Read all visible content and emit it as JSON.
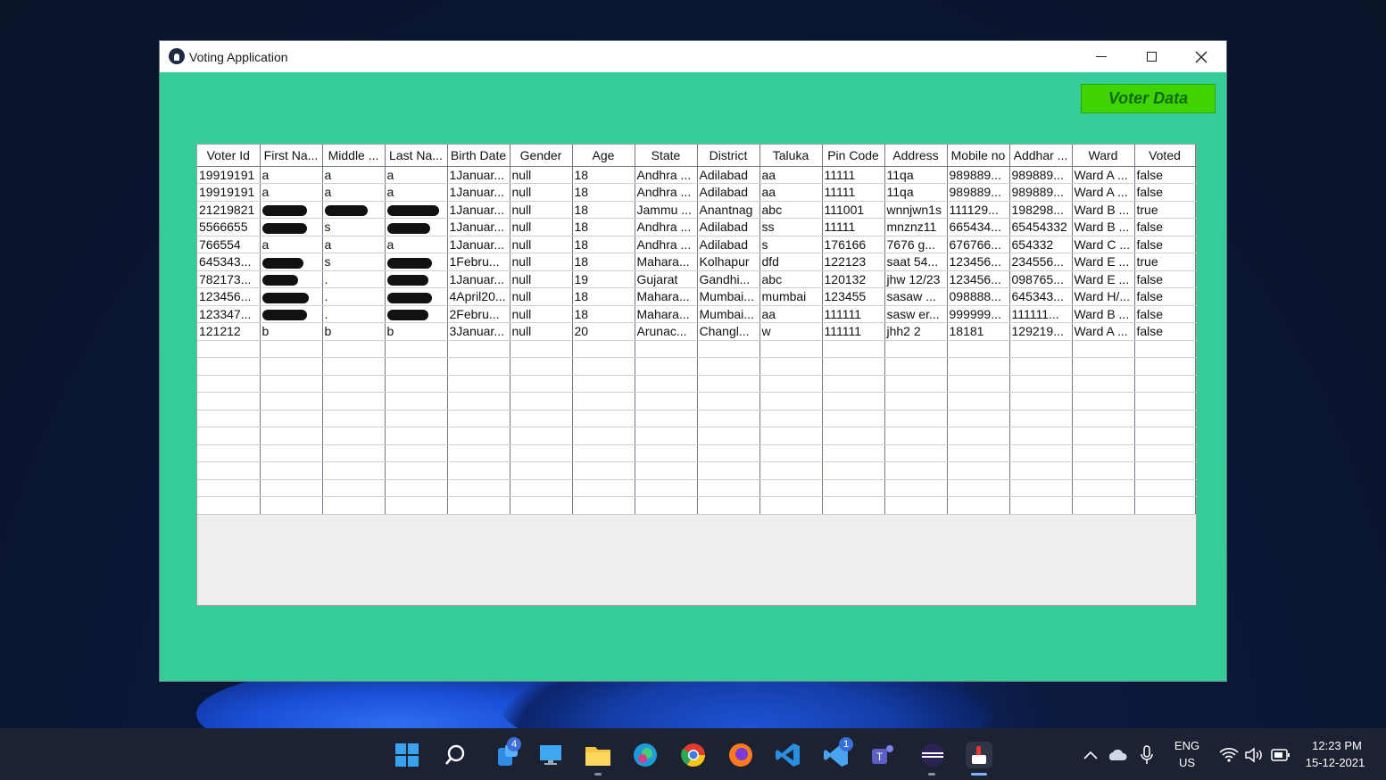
{
  "window": {
    "title": "Voting Application",
    "voter_data_button": "Voter Data"
  },
  "table": {
    "columns": [
      "Voter Id",
      "First Na...",
      "Middle ...",
      "Last Na...",
      "Birth Date",
      "Gender",
      "Age",
      "State",
      "District",
      "Taluka",
      "Pin Code",
      "Address",
      "Mobile no",
      "Addhar ...",
      "Ward",
      "Voted"
    ],
    "rows": [
      [
        "19919191",
        "a",
        "a",
        "a",
        "1Januar...",
        "null",
        "18",
        "Andhra ...",
        "Adilabad",
        "aa",
        "11111",
        "11qa",
        "989889...",
        "989889...",
        "Ward A ...",
        "false"
      ],
      [
        "19919191",
        "a",
        "a",
        "a",
        "1Januar...",
        "null",
        "18",
        "Andhra ...",
        "Adilabad",
        "aa",
        "11111",
        "11qa",
        "989889...",
        "989889...",
        "Ward A ...",
        "false"
      ],
      [
        "21219821",
        "",
        "",
        "",
        "1Januar...",
        "null",
        "18",
        "Jammu ...",
        "Anantnag",
        "abc",
        "111001",
        "wnnjwn1s",
        "111129...",
        "198298...",
        "Ward B ...",
        "true"
      ],
      [
        "5566655",
        "",
        "s",
        "",
        "1Januar...",
        "null",
        "18",
        "Andhra ...",
        "Adilabad",
        "ss",
        "11111",
        "mnznz11",
        "665434...",
        "65454332",
        "Ward B ...",
        "false"
      ],
      [
        "766554",
        "a",
        "a",
        "a",
        "1Januar...",
        "null",
        "18",
        "Andhra ...",
        "Adilabad",
        "s",
        "176166",
        "7676 g...",
        "676766...",
        "654332",
        "Ward C ...",
        "false"
      ],
      [
        "645343...",
        "",
        "s",
        "",
        "1Febru...",
        "null",
        "18",
        "Mahara...",
        "Kolhapur",
        "dfd",
        "122123",
        "saat 54...",
        "123456...",
        "234556...",
        "Ward E ...",
        "true"
      ],
      [
        "782173...",
        "",
        ".",
        "",
        "1Januar...",
        "null",
        "19",
        "Gujarat",
        "Gandhi...",
        "abc",
        "120132",
        "jhw 12/23",
        "123456...",
        "098765...",
        "Ward E ...",
        "false"
      ],
      [
        "123456...",
        "",
        ".",
        "",
        "4April20...",
        "null",
        "18",
        "Mahara...",
        "Mumbai...",
        "mumbai",
        "123455",
        "sasaw ...",
        "098888...",
        "645343...",
        "Ward H/...",
        "false"
      ],
      [
        "123347...",
        "",
        ".",
        "",
        "2Febru...",
        "null",
        "18",
        "Mahara...",
        "Mumbai...",
        "aa",
        "111111",
        "sasw er...",
        "999999...",
        "111111...",
        "Ward B ...",
        "false"
      ],
      [
        "121212",
        "b",
        "b",
        "b",
        "3Januar...",
        "null",
        "20",
        "Arunac...",
        "Changl...",
        "w",
        "111111",
        "jhh2  2",
        "18181",
        "129219...",
        "Ward A ...",
        "false"
      ]
    ],
    "empty_rows": 10
  },
  "taskbar": {
    "badges": {
      "widgets": "4",
      "vscode_blue": "1"
    },
    "language": "ENG",
    "region": "US",
    "time": "12:23 PM",
    "date": "15-12-2021"
  }
}
